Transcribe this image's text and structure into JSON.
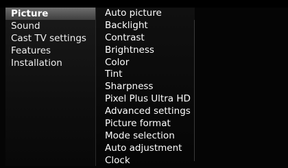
{
  "main_menu": {
    "items": [
      {
        "label": "Picture",
        "active": true
      },
      {
        "label": "Sound",
        "active": false
      },
      {
        "label": "Cast TV settings",
        "active": false
      },
      {
        "label": "Features",
        "active": false
      },
      {
        "label": "Installation",
        "active": false
      }
    ]
  },
  "sub_menu": {
    "items": [
      {
        "label": "Auto picture"
      },
      {
        "label": "Backlight"
      },
      {
        "label": "Contrast"
      },
      {
        "label": "Brightness"
      },
      {
        "label": "Color"
      },
      {
        "label": "Tint"
      },
      {
        "label": "Sharpness"
      },
      {
        "label": "Pixel Plus Ultra HD"
      },
      {
        "label": "Advanced settings"
      },
      {
        "label": "Picture format"
      },
      {
        "label": "Mode selection"
      },
      {
        "label": "Auto adjustment"
      },
      {
        "label": "Clock"
      }
    ]
  },
  "colors": {
    "highlight": "#5a5a5a",
    "background": "#000000",
    "text": "#ffffff"
  }
}
